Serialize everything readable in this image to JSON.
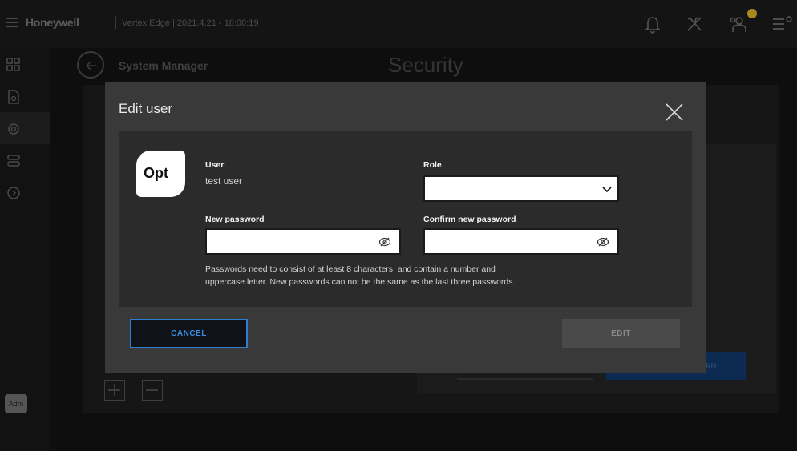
{
  "topbar": {
    "brand": "Honeywell",
    "subtitle": "Vertex Edge | 2021.4.21 - 18:08:19",
    "icons": [
      "bell-icon",
      "tools-icon",
      "users-icon",
      "list-settings-icon"
    ],
    "badge_color": "#a8891f"
  },
  "leftnav": {
    "items": [
      "dashboard-icon",
      "document-icon",
      "settings-icon",
      "devices-icon",
      "info-icon"
    ],
    "avatar_label": "Adm"
  },
  "page": {
    "breadcrumb": "System Manager",
    "title": "Security",
    "background_button_label": "RD"
  },
  "modal": {
    "title": "Edit user",
    "logo_text": "Opt",
    "user_label": "User",
    "user_value": "test user",
    "role_label": "Role",
    "role_value": "",
    "new_password_label": "New password",
    "new_password_value": "",
    "confirm_password_label": "Confirm new password",
    "confirm_password_value": "",
    "hint_line1": "Passwords need to consist of at least 8 characters, and contain a number and",
    "hint_line2": "uppercase letter. New passwords can not be the same as the last three passwords.",
    "cancel_label": "CANCEL",
    "edit_label": "EDIT"
  },
  "colors": {
    "accent_blue": "#2f7fd1",
    "modal_bg": "#393939",
    "modal_body_bg": "#2b2b2b"
  }
}
